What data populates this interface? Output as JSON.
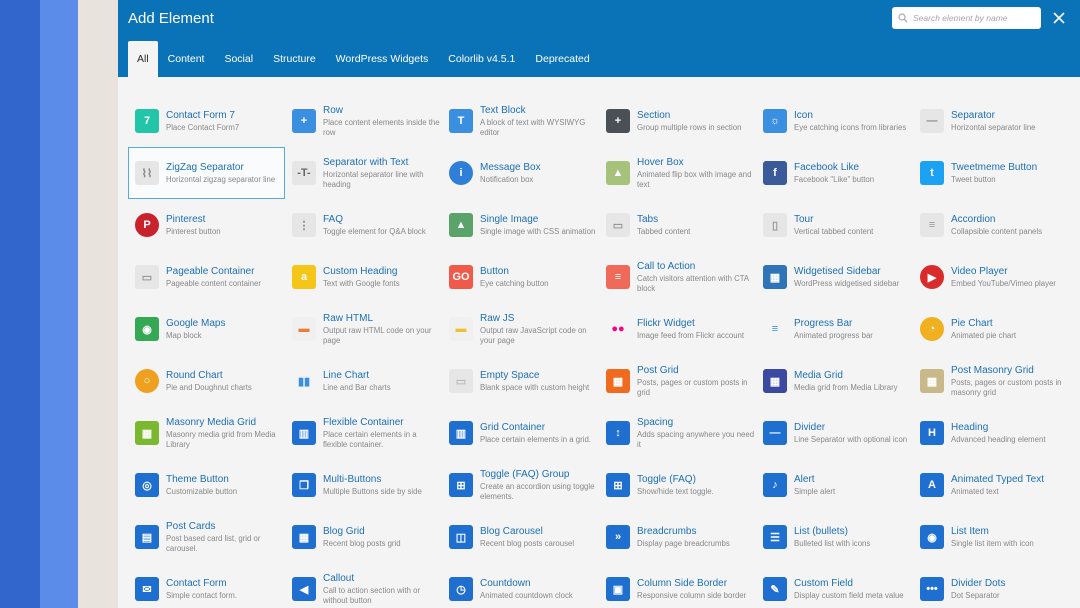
{
  "modal": {
    "title": "Add Element",
    "search_placeholder": "Search element by name"
  },
  "tabs": [
    {
      "label": "All",
      "active": true
    },
    {
      "label": "Content"
    },
    {
      "label": "Social"
    },
    {
      "label": "Structure"
    },
    {
      "label": "WordPress Widgets"
    },
    {
      "label": "Colorlib v4.5.1"
    },
    {
      "label": "Deprecated"
    }
  ],
  "colors": {
    "header": "#0a73b7",
    "accent_blue": "#1d6fb5",
    "selected_border": "#5aa9dc"
  },
  "elements": [
    {
      "name": "Contact Form 7",
      "desc": "Place Contact Form7",
      "icon": "contact-form-7-icon",
      "color": "#22c5a7",
      "glyph": "7"
    },
    {
      "name": "Row",
      "desc": "Place content elements inside the row",
      "icon": "row-plus-icon",
      "color": "#3b8fe0",
      "glyph": "+"
    },
    {
      "name": "Text Block",
      "desc": "A block of text with WYSIWYG editor",
      "icon": "text-block-icon",
      "color": "#3b8fe0",
      "glyph": "T"
    },
    {
      "name": "Section",
      "desc": "Group multiple rows in section",
      "icon": "section-plus-icon",
      "color": "#4b4f56",
      "glyph": "+"
    },
    {
      "name": "Icon",
      "desc": "Eye catching icons from libraries",
      "icon": "sun-icon",
      "color": "#3b8fe0",
      "glyph": "☼"
    },
    {
      "name": "Separator",
      "desc": "Horizontal separator line",
      "icon": "separator-line-icon",
      "color": "#e6e6e6",
      "glyph": "—",
      "fg": "#888"
    },
    {
      "name": "ZigZag Separator",
      "desc": "Horizontal zigzag separator line",
      "icon": "zigzag-separator-icon",
      "color": "#e6e6e6",
      "glyph": "⌇⌇",
      "fg": "#888",
      "selected": true
    },
    {
      "name": "Separator with Text",
      "desc": "Horizontal separator line with heading",
      "icon": "separator-text-icon",
      "color": "#e6e6e6",
      "glyph": "-T-",
      "fg": "#666"
    },
    {
      "name": "Message Box",
      "desc": "Notification box",
      "icon": "info-icon",
      "color": "#2f7fd8",
      "glyph": "i",
      "shape": "circle"
    },
    {
      "name": "Hover Box",
      "desc": "Animated flip box with image and text",
      "icon": "hover-box-icon",
      "color": "#a7c27a",
      "glyph": "▲"
    },
    {
      "name": "Facebook Like",
      "desc": "Facebook \"Like\" button",
      "icon": "facebook-icon",
      "color": "#3b5a9a",
      "glyph": "f"
    },
    {
      "name": "Tweetmeme Button",
      "desc": "Tweet button",
      "icon": "twitter-icon",
      "color": "#1da1f2",
      "glyph": "t"
    },
    {
      "name": "Pinterest",
      "desc": "Pinterest button",
      "icon": "pinterest-icon",
      "color": "#c8232c",
      "glyph": "P",
      "shape": "circle"
    },
    {
      "name": "FAQ",
      "desc": "Toggle element for Q&A block",
      "icon": "faq-icon",
      "color": "#e6e6e6",
      "glyph": "⋮",
      "fg": "#888"
    },
    {
      "name": "Single Image",
      "desc": "Single image with CSS animation",
      "icon": "image-icon",
      "color": "#5aa46b",
      "glyph": "▲"
    },
    {
      "name": "Tabs",
      "desc": "Tabbed content",
      "icon": "tabs-icon",
      "color": "#e6e6e6",
      "glyph": "▭",
      "fg": "#999"
    },
    {
      "name": "Tour",
      "desc": "Vertical tabbed content",
      "icon": "tour-icon",
      "color": "#e6e6e6",
      "glyph": "▯",
      "fg": "#999"
    },
    {
      "name": "Accordion",
      "desc": "Collapsible content panels",
      "icon": "accordion-icon",
      "color": "#e6e6e6",
      "glyph": "≡",
      "fg": "#999"
    },
    {
      "name": "Pageable Container",
      "desc": "Pageable content container",
      "icon": "pageable-container-icon",
      "color": "#e6e6e6",
      "glyph": "▭",
      "fg": "#999"
    },
    {
      "name": "Custom Heading",
      "desc": "Text with Google fonts",
      "icon": "custom-heading-icon",
      "color": "#f5c518",
      "glyph": "a"
    },
    {
      "name": "Button",
      "desc": "Eye catching button",
      "icon": "button-icon",
      "color": "#f05a4a",
      "glyph": "GO"
    },
    {
      "name": "Call to Action",
      "desc": "Catch visitors attention with CTA block",
      "icon": "call-to-action-icon",
      "color": "#f06a5a",
      "glyph": "≡"
    },
    {
      "name": "Widgetised Sidebar",
      "desc": "WordPress widgetised sidebar",
      "icon": "widgetised-sidebar-icon",
      "color": "#2f74b8",
      "glyph": "▦"
    },
    {
      "name": "Video Player",
      "desc": "Embed YouTube/Vimeo player",
      "icon": "video-player-icon",
      "color": "#d92b2b",
      "glyph": "▶",
      "shape": "circle"
    },
    {
      "name": "Google Maps",
      "desc": "Map block",
      "icon": "google-maps-icon",
      "color": "#34a853",
      "glyph": "◉"
    },
    {
      "name": "Raw HTML",
      "desc": "Output raw HTML code on your page",
      "icon": "raw-html-icon",
      "color": "#f0f0f0",
      "glyph": "▬",
      "fg": "#f07a3a"
    },
    {
      "name": "Raw JS",
      "desc": "Output raw JavaScript code on your page",
      "icon": "raw-js-icon",
      "color": "#f0f0f0",
      "glyph": "▬",
      "fg": "#f0c030"
    },
    {
      "name": "Flickr Widget",
      "desc": "Image feed from Flickr account",
      "icon": "flickr-icon",
      "color": "#f4f4f4",
      "glyph": "●●",
      "fg": "#ff0084"
    },
    {
      "name": "Progress Bar",
      "desc": "Animated progress bar",
      "icon": "progress-bar-icon",
      "color": "#f4f4f4",
      "glyph": "≡",
      "fg": "#3b8fe0"
    },
    {
      "name": "Pie Chart",
      "desc": "Animated pie chart",
      "icon": "pie-chart-icon",
      "color": "#f0b020",
      "glyph": "◔",
      "shape": "circle"
    },
    {
      "name": "Round Chart",
      "desc": "Pie and Doughnut charts",
      "icon": "round-chart-icon",
      "color": "#f0a020",
      "glyph": "○",
      "shape": "circle"
    },
    {
      "name": "Line Chart",
      "desc": "Line and Bar charts",
      "icon": "line-chart-icon",
      "color": "#f4f4f4",
      "glyph": "▮▮",
      "fg": "#3b8fe0"
    },
    {
      "name": "Empty Space",
      "desc": "Blank space with custom height",
      "icon": "empty-space-icon",
      "color": "#e6e6e6",
      "glyph": "▭",
      "fg": "#bbb"
    },
    {
      "name": "Post Grid",
      "desc": "Posts, pages or custom posts in grid",
      "icon": "post-grid-icon",
      "color": "#f06a20",
      "glyph": "▦"
    },
    {
      "name": "Media Grid",
      "desc": "Media grid from Media Library",
      "icon": "media-grid-icon",
      "color": "#3b4aa0",
      "glyph": "▦"
    },
    {
      "name": "Post Masonry Grid",
      "desc": "Posts, pages or custom posts in masonry grid",
      "icon": "post-masonry-grid-icon",
      "color": "#c8b88a",
      "glyph": "▦"
    },
    {
      "name": "Masonry Media Grid",
      "desc": "Masonry media grid from Media Library",
      "icon": "masonry-media-grid-icon",
      "color": "#7ab830",
      "glyph": "▦"
    },
    {
      "name": "Flexible Container",
      "desc": "Place certain elements in a flexible container.",
      "icon": "flexible-container-icon",
      "color": "#1f6fd0",
      "glyph": "▥"
    },
    {
      "name": "Grid Container",
      "desc": "Place certain elements in a grid.",
      "icon": "grid-container-icon",
      "color": "#1f6fd0",
      "glyph": "▥"
    },
    {
      "name": "Spacing",
      "desc": "Adds spacing anywhere you need it",
      "icon": "spacing-icon",
      "color": "#1f6fd0",
      "glyph": "↕"
    },
    {
      "name": "Divider",
      "desc": "Line Separator with optional icon",
      "icon": "divider-icon",
      "color": "#1f6fd0",
      "glyph": "—"
    },
    {
      "name": "Heading",
      "desc": "Advanced heading element",
      "icon": "heading-icon",
      "color": "#1f6fd0",
      "glyph": "H"
    },
    {
      "name": "Theme Button",
      "desc": "Customizable button",
      "icon": "theme-button-icon",
      "color": "#1f6fd0",
      "glyph": "◎"
    },
    {
      "name": "Multi-Buttons",
      "desc": "Multiple Buttons side by side",
      "icon": "multi-buttons-icon",
      "color": "#1f6fd0",
      "glyph": "❐"
    },
    {
      "name": "Toggle (FAQ) Group",
      "desc": "Create an accordion using toggle elements.",
      "icon": "toggle-group-icon",
      "color": "#1f6fd0",
      "glyph": "⊞"
    },
    {
      "name": "Toggle (FAQ)",
      "desc": "Show/hide text toggle.",
      "icon": "toggle-icon",
      "color": "#1f6fd0",
      "glyph": "⊞"
    },
    {
      "name": "Alert",
      "desc": "Simple alert",
      "icon": "bell-icon",
      "color": "#1f6fd0",
      "glyph": "♪"
    },
    {
      "name": "Animated Typed Text",
      "desc": "Animated text",
      "icon": "typed-text-icon",
      "color": "#1f6fd0",
      "glyph": "A"
    },
    {
      "name": "Post Cards",
      "desc": "Post based card list, grid or carousel.",
      "icon": "post-cards-icon",
      "color": "#1f6fd0",
      "glyph": "▤"
    },
    {
      "name": "Blog Grid",
      "desc": "Recent blog posts grid",
      "icon": "blog-grid-icon",
      "color": "#1f6fd0",
      "glyph": "▦"
    },
    {
      "name": "Blog Carousel",
      "desc": "Recent blog posts carousel",
      "icon": "blog-carousel-icon",
      "color": "#1f6fd0",
      "glyph": "◫"
    },
    {
      "name": "Breadcrumbs",
      "desc": "Display page breadcrumbs",
      "icon": "breadcrumbs-icon",
      "color": "#1f6fd0",
      "glyph": "»"
    },
    {
      "name": "List (bullets)",
      "desc": "Bulleted list with icons",
      "icon": "bullet-list-icon",
      "color": "#1f6fd0",
      "glyph": "☰"
    },
    {
      "name": "List Item",
      "desc": "Single list item with icon",
      "icon": "list-item-icon",
      "color": "#1f6fd0",
      "glyph": "◉"
    },
    {
      "name": "Contact Form",
      "desc": "Simple contact form.",
      "icon": "envelope-icon",
      "color": "#1f6fd0",
      "glyph": "✉"
    },
    {
      "name": "Callout",
      "desc": "Call to action section with or without button",
      "icon": "megaphone-icon",
      "color": "#1f6fd0",
      "glyph": "◀"
    },
    {
      "name": "Countdown",
      "desc": "Animated countdown clock",
      "icon": "clock-icon",
      "color": "#1f6fd0",
      "glyph": "◷"
    },
    {
      "name": "Column Side Border",
      "desc": "Responsive column side border",
      "icon": "column-border-icon",
      "color": "#1f6fd0",
      "glyph": "▣"
    },
    {
      "name": "Custom Field",
      "desc": "Display custom field meta value",
      "icon": "wrench-icon",
      "color": "#1f6fd0",
      "glyph": "✎"
    },
    {
      "name": "Divider Dots",
      "desc": "Dot Separator",
      "icon": "dots-icon",
      "color": "#1f6fd0",
      "glyph": "•••"
    }
  ]
}
